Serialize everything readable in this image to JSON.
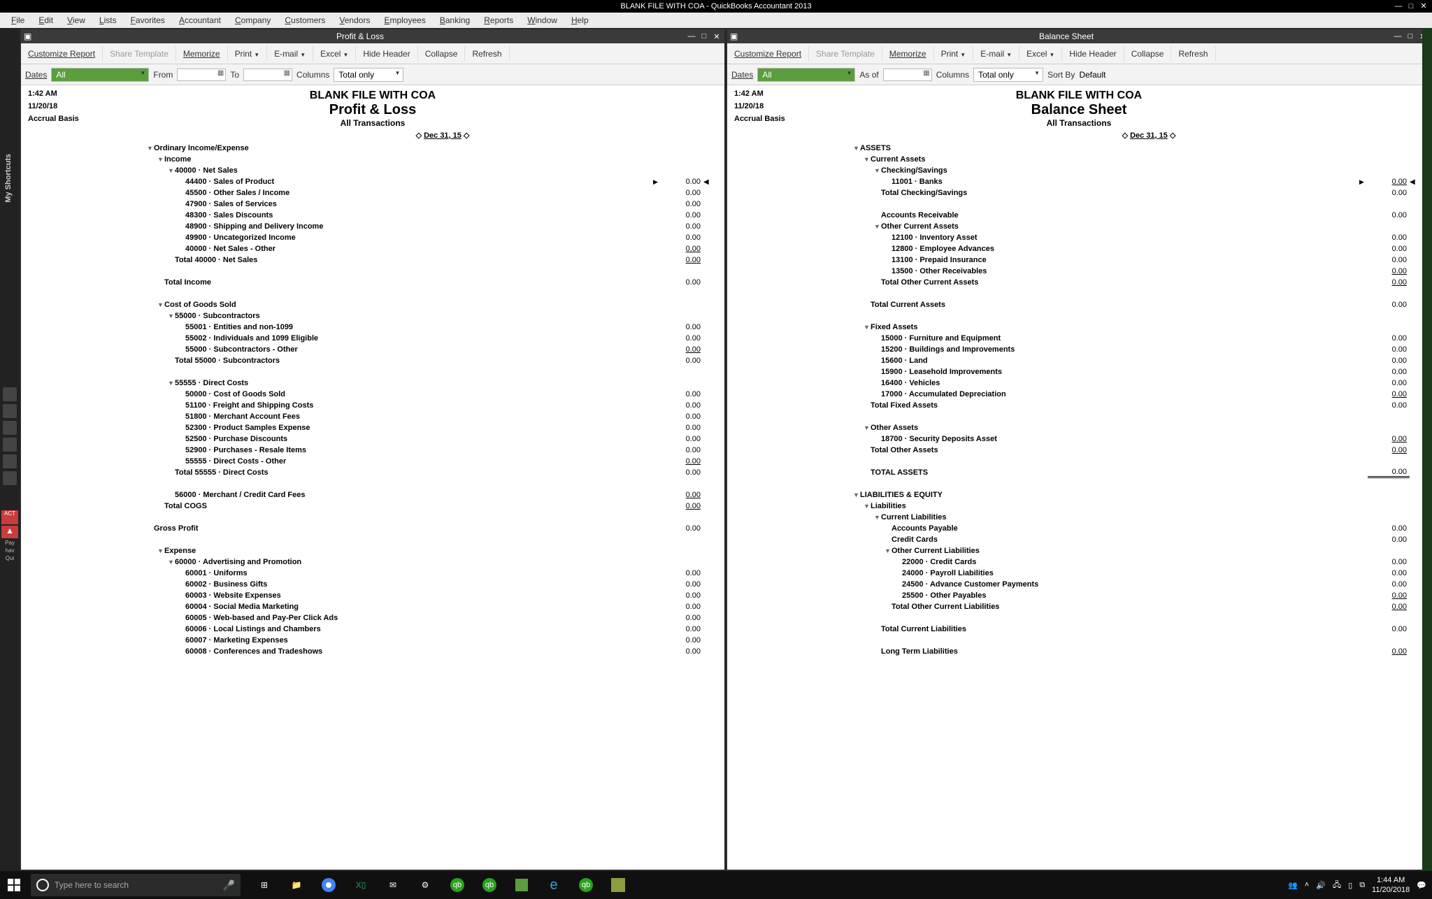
{
  "app": {
    "title": "BLANK FILE WITH COA  - QuickBooks Accountant 2013"
  },
  "menubar": [
    "File",
    "Edit",
    "View",
    "Lists",
    "Favorites",
    "Accountant",
    "Company",
    "Customers",
    "Vendors",
    "Employees",
    "Banking",
    "Reports",
    "Window",
    "Help"
  ],
  "shortcuts": {
    "label": "My Shortcuts",
    "act": "ACT",
    "pay": "Pay",
    "hav": "hav",
    "qui": "Qui"
  },
  "toolbar": {
    "customize": "Customize Report",
    "share": "Share Template",
    "memorize": "Memorize",
    "print": "Print",
    "email": "E-mail",
    "excel": "Excel",
    "hide": "Hide Header",
    "collapse": "Collapse",
    "refresh": "Refresh"
  },
  "filters": {
    "dates": "Dates",
    "all": "All",
    "from": "From",
    "to": "To",
    "asof": "As of",
    "columns": "Columns",
    "total_only": "Total only",
    "sortby": "Sort By",
    "default": "Default"
  },
  "meta": {
    "time": "1:42 AM",
    "date": "11/20/18",
    "basis": "Accrual Basis"
  },
  "header": {
    "company": "BLANK FILE WITH COA",
    "dateline": "Dec 31, 15",
    "alltrans": "All Transactions"
  },
  "pl": {
    "title": "Profit & Loss",
    "rows": [
      {
        "ind": 0,
        "tw": "▼",
        "lbl": "Ordinary Income/Expense"
      },
      {
        "ind": 1,
        "tw": "▼",
        "lbl": "Income"
      },
      {
        "ind": 2,
        "tw": "▼",
        "lbl": "40000 · Net Sales"
      },
      {
        "ind": 3,
        "lbl": "44400 · Sales of Product",
        "val": "0.00",
        "arrow": "▶",
        "marker": "◀"
      },
      {
        "ind": 3,
        "lbl": "45500 · Other Sales / Income",
        "val": "0.00"
      },
      {
        "ind": 3,
        "lbl": "47900 · Sales of Services",
        "val": "0.00"
      },
      {
        "ind": 3,
        "lbl": "48300 · Sales Discounts",
        "val": "0.00"
      },
      {
        "ind": 3,
        "lbl": "48900 · Shipping and Delivery Income",
        "val": "0.00"
      },
      {
        "ind": 3,
        "lbl": "49900 · Uncategorized Income",
        "val": "0.00"
      },
      {
        "ind": 3,
        "lbl": "40000 · Net Sales - Other",
        "val": "0.00",
        "u": true
      },
      {
        "ind": 2,
        "lbl": "Total 40000 · Net Sales",
        "val": "0.00",
        "u": true
      },
      {
        "ind": 0,
        "lbl": ""
      },
      {
        "ind": 1,
        "lbl": "Total Income",
        "val": "0.00"
      },
      {
        "ind": 0,
        "lbl": ""
      },
      {
        "ind": 1,
        "tw": "▼",
        "lbl": "Cost of Goods Sold"
      },
      {
        "ind": 2,
        "tw": "▼",
        "lbl": "55000 · Subcontractors"
      },
      {
        "ind": 3,
        "lbl": "55001 · Entities and non-1099",
        "val": "0.00"
      },
      {
        "ind": 3,
        "lbl": "55002 · Individuals and 1099 Eligible",
        "val": "0.00"
      },
      {
        "ind": 3,
        "lbl": "55000 · Subcontractors - Other",
        "val": "0.00",
        "u": true
      },
      {
        "ind": 2,
        "lbl": "Total 55000 · Subcontractors",
        "val": "0.00"
      },
      {
        "ind": 0,
        "lbl": ""
      },
      {
        "ind": 2,
        "tw": "▼",
        "lbl": "55555 · Direct Costs"
      },
      {
        "ind": 3,
        "lbl": "50000 · Cost of Goods Sold",
        "val": "0.00"
      },
      {
        "ind": 3,
        "lbl": "51100 · Freight and Shipping Costs",
        "val": "0.00"
      },
      {
        "ind": 3,
        "lbl": "51800 · Merchant Account Fees",
        "val": "0.00"
      },
      {
        "ind": 3,
        "lbl": "52300 · Product Samples Expense",
        "val": "0.00"
      },
      {
        "ind": 3,
        "lbl": "52500 · Purchase Discounts",
        "val": "0.00"
      },
      {
        "ind": 3,
        "lbl": "52900 · Purchases - Resale Items",
        "val": "0.00"
      },
      {
        "ind": 3,
        "lbl": "55555 · Direct Costs - Other",
        "val": "0.00",
        "u": true
      },
      {
        "ind": 2,
        "lbl": "Total 55555 · Direct Costs",
        "val": "0.00"
      },
      {
        "ind": 0,
        "lbl": ""
      },
      {
        "ind": 2,
        "lbl": "56000 · Merchant / Credit Card Fees",
        "val": "0.00",
        "u": true
      },
      {
        "ind": 1,
        "lbl": "Total COGS",
        "val": "0.00",
        "u": true
      },
      {
        "ind": 0,
        "lbl": ""
      },
      {
        "ind": 0,
        "lbl": "Gross Profit",
        "val": "0.00"
      },
      {
        "ind": 0,
        "lbl": ""
      },
      {
        "ind": 1,
        "tw": "▼",
        "lbl": "Expense"
      },
      {
        "ind": 2,
        "tw": "▼",
        "lbl": "60000 · Advertising and Promotion"
      },
      {
        "ind": 3,
        "lbl": "60001 · Uniforms",
        "val": "0.00"
      },
      {
        "ind": 3,
        "lbl": "60002 · Business Gifts",
        "val": "0.00"
      },
      {
        "ind": 3,
        "lbl": "60003 · Website Expenses",
        "val": "0.00"
      },
      {
        "ind": 3,
        "lbl": "60004 · Social Media Marketing",
        "val": "0.00"
      },
      {
        "ind": 3,
        "lbl": "60005 · Web-based and Pay-Per Click Ads",
        "val": "0.00"
      },
      {
        "ind": 3,
        "lbl": "60006 · Local Listings and Chambers",
        "val": "0.00"
      },
      {
        "ind": 3,
        "lbl": "60007 · Marketing Expenses",
        "val": "0.00"
      },
      {
        "ind": 3,
        "lbl": "60008 · Conferences and Tradeshows",
        "val": "0.00"
      }
    ]
  },
  "bs": {
    "title": "Balance Sheet",
    "rows": [
      {
        "ind": 0,
        "tw": "▼",
        "lbl": "ASSETS"
      },
      {
        "ind": 1,
        "tw": "▼",
        "lbl": "Current Assets"
      },
      {
        "ind": 2,
        "tw": "▼",
        "lbl": "Checking/Savings"
      },
      {
        "ind": 3,
        "lbl": "11001 · Banks",
        "val": "0.00",
        "arrow": "▶",
        "marker": "◀",
        "u": true
      },
      {
        "ind": 2,
        "lbl": "Total Checking/Savings",
        "val": "0.00"
      },
      {
        "ind": 0,
        "lbl": ""
      },
      {
        "ind": 2,
        "lbl": "Accounts Receivable",
        "val": "0.00"
      },
      {
        "ind": 2,
        "tw": "▼",
        "lbl": "Other Current Assets"
      },
      {
        "ind": 3,
        "lbl": "12100 · Inventory Asset",
        "val": "0.00"
      },
      {
        "ind": 3,
        "lbl": "12800 · Employee Advances",
        "val": "0.00"
      },
      {
        "ind": 3,
        "lbl": "13100 · Prepaid Insurance",
        "val": "0.00"
      },
      {
        "ind": 3,
        "lbl": "13500 · Other Receivables",
        "val": "0.00",
        "u": true
      },
      {
        "ind": 2,
        "lbl": "Total Other Current Assets",
        "val": "0.00",
        "u": true
      },
      {
        "ind": 0,
        "lbl": ""
      },
      {
        "ind": 1,
        "lbl": "Total Current Assets",
        "val": "0.00"
      },
      {
        "ind": 0,
        "lbl": ""
      },
      {
        "ind": 1,
        "tw": "▼",
        "lbl": "Fixed Assets"
      },
      {
        "ind": 2,
        "lbl": "15000 · Furniture and Equipment",
        "val": "0.00"
      },
      {
        "ind": 2,
        "lbl": "15200 · Buildings and Improvements",
        "val": "0.00"
      },
      {
        "ind": 2,
        "lbl": "15600 · Land",
        "val": "0.00"
      },
      {
        "ind": 2,
        "lbl": "15900 · Leasehold Improvements",
        "val": "0.00"
      },
      {
        "ind": 2,
        "lbl": "16400 · Vehicles",
        "val": "0.00"
      },
      {
        "ind": 2,
        "lbl": "17000 · Accumulated Depreciation",
        "val": "0.00",
        "u": true
      },
      {
        "ind": 1,
        "lbl": "Total Fixed Assets",
        "val": "0.00"
      },
      {
        "ind": 0,
        "lbl": ""
      },
      {
        "ind": 1,
        "tw": "▼",
        "lbl": "Other Assets"
      },
      {
        "ind": 2,
        "lbl": "18700 · Security Deposits Asset",
        "val": "0.00",
        "u": true
      },
      {
        "ind": 1,
        "lbl": "Total Other Assets",
        "val": "0.00",
        "u": true
      },
      {
        "ind": 0,
        "lbl": ""
      },
      {
        "ind": 1,
        "lbl": "TOTAL ASSETS",
        "val": "0.00",
        "uu": true
      },
      {
        "ind": 0,
        "lbl": ""
      },
      {
        "ind": 0,
        "tw": "▼",
        "lbl": "LIABILITIES & EQUITY"
      },
      {
        "ind": 1,
        "tw": "▼",
        "lbl": "Liabilities"
      },
      {
        "ind": 2,
        "tw": "▼",
        "lbl": "Current Liabilities"
      },
      {
        "ind": 3,
        "lbl": "Accounts Payable",
        "val": "0.00"
      },
      {
        "ind": 3,
        "lbl": "Credit Cards",
        "val": "0.00"
      },
      {
        "ind": 3,
        "tw": "▼",
        "lbl": "Other Current Liabilities"
      },
      {
        "ind": 4,
        "lbl": "22000 · Credit Cards",
        "val": "0.00"
      },
      {
        "ind": 4,
        "lbl": "24000 · Payroll Liabilities",
        "val": "0.00"
      },
      {
        "ind": 4,
        "lbl": "24500 · Advance Customer Payments",
        "val": "0.00"
      },
      {
        "ind": 4,
        "lbl": "25500 · Other Payables",
        "val": "0.00",
        "u": true
      },
      {
        "ind": 3,
        "lbl": "Total Other Current Liabilities",
        "val": "0.00",
        "u": true
      },
      {
        "ind": 0,
        "lbl": ""
      },
      {
        "ind": 2,
        "lbl": "Total Current Liabilities",
        "val": "0.00"
      },
      {
        "ind": 0,
        "lbl": ""
      },
      {
        "ind": 2,
        "lbl": "Long Term Liabilities",
        "val": "0.00",
        "u": true
      }
    ]
  },
  "taskbar": {
    "search_placeholder": "Type here to search",
    "time": "1:44 AM",
    "date": "11/20/2018"
  }
}
